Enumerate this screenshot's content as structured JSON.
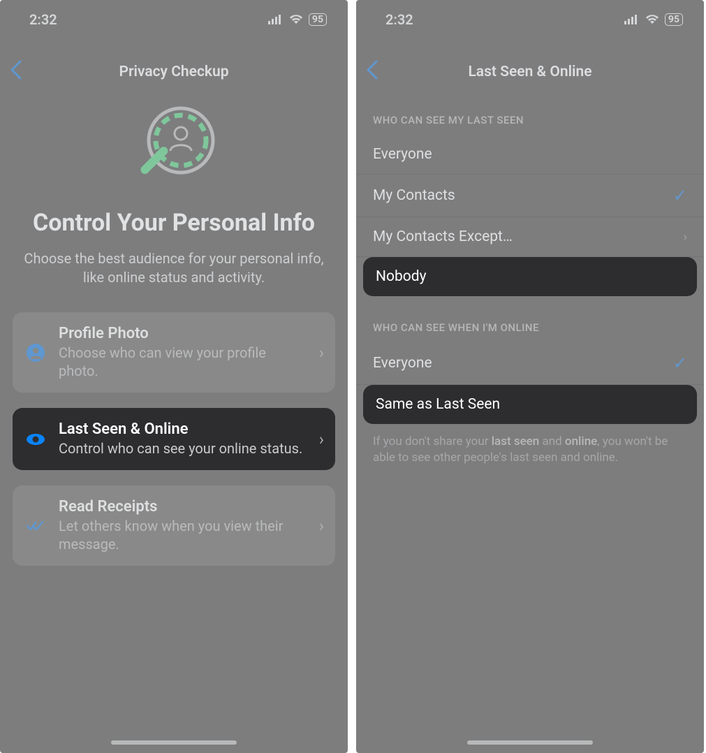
{
  "status": {
    "time": "2:32",
    "battery": "95"
  },
  "screen1": {
    "nav_title": "Privacy Checkup",
    "heading": "Control Your Personal Info",
    "subheading": "Choose the best audience for your personal info, like online status and activity.",
    "options": [
      {
        "title": "Profile Photo",
        "desc": "Choose who can view your profile photo."
      },
      {
        "title": "Last Seen & Online",
        "desc": "Control who can see your online status."
      },
      {
        "title": "Read Receipts",
        "desc": "Let others know when you view their message."
      }
    ]
  },
  "screen2": {
    "nav_title": "Last Seen & Online",
    "section1": {
      "header": "WHO CAN SEE MY LAST SEEN",
      "items": [
        {
          "label": "Everyone"
        },
        {
          "label": "My Contacts"
        },
        {
          "label": "My Contacts Except…"
        },
        {
          "label": "Nobody"
        }
      ]
    },
    "section2": {
      "header": "WHO CAN SEE WHEN I'M ONLINE",
      "items": [
        {
          "label": "Everyone"
        },
        {
          "label": "Same as Last Seen"
        }
      ]
    },
    "footer": {
      "pre": "If you don't share your ",
      "em1": "last seen",
      "mid": " and ",
      "em2": "online",
      "post": ", you won't be able to see other people's last seen and online."
    }
  }
}
